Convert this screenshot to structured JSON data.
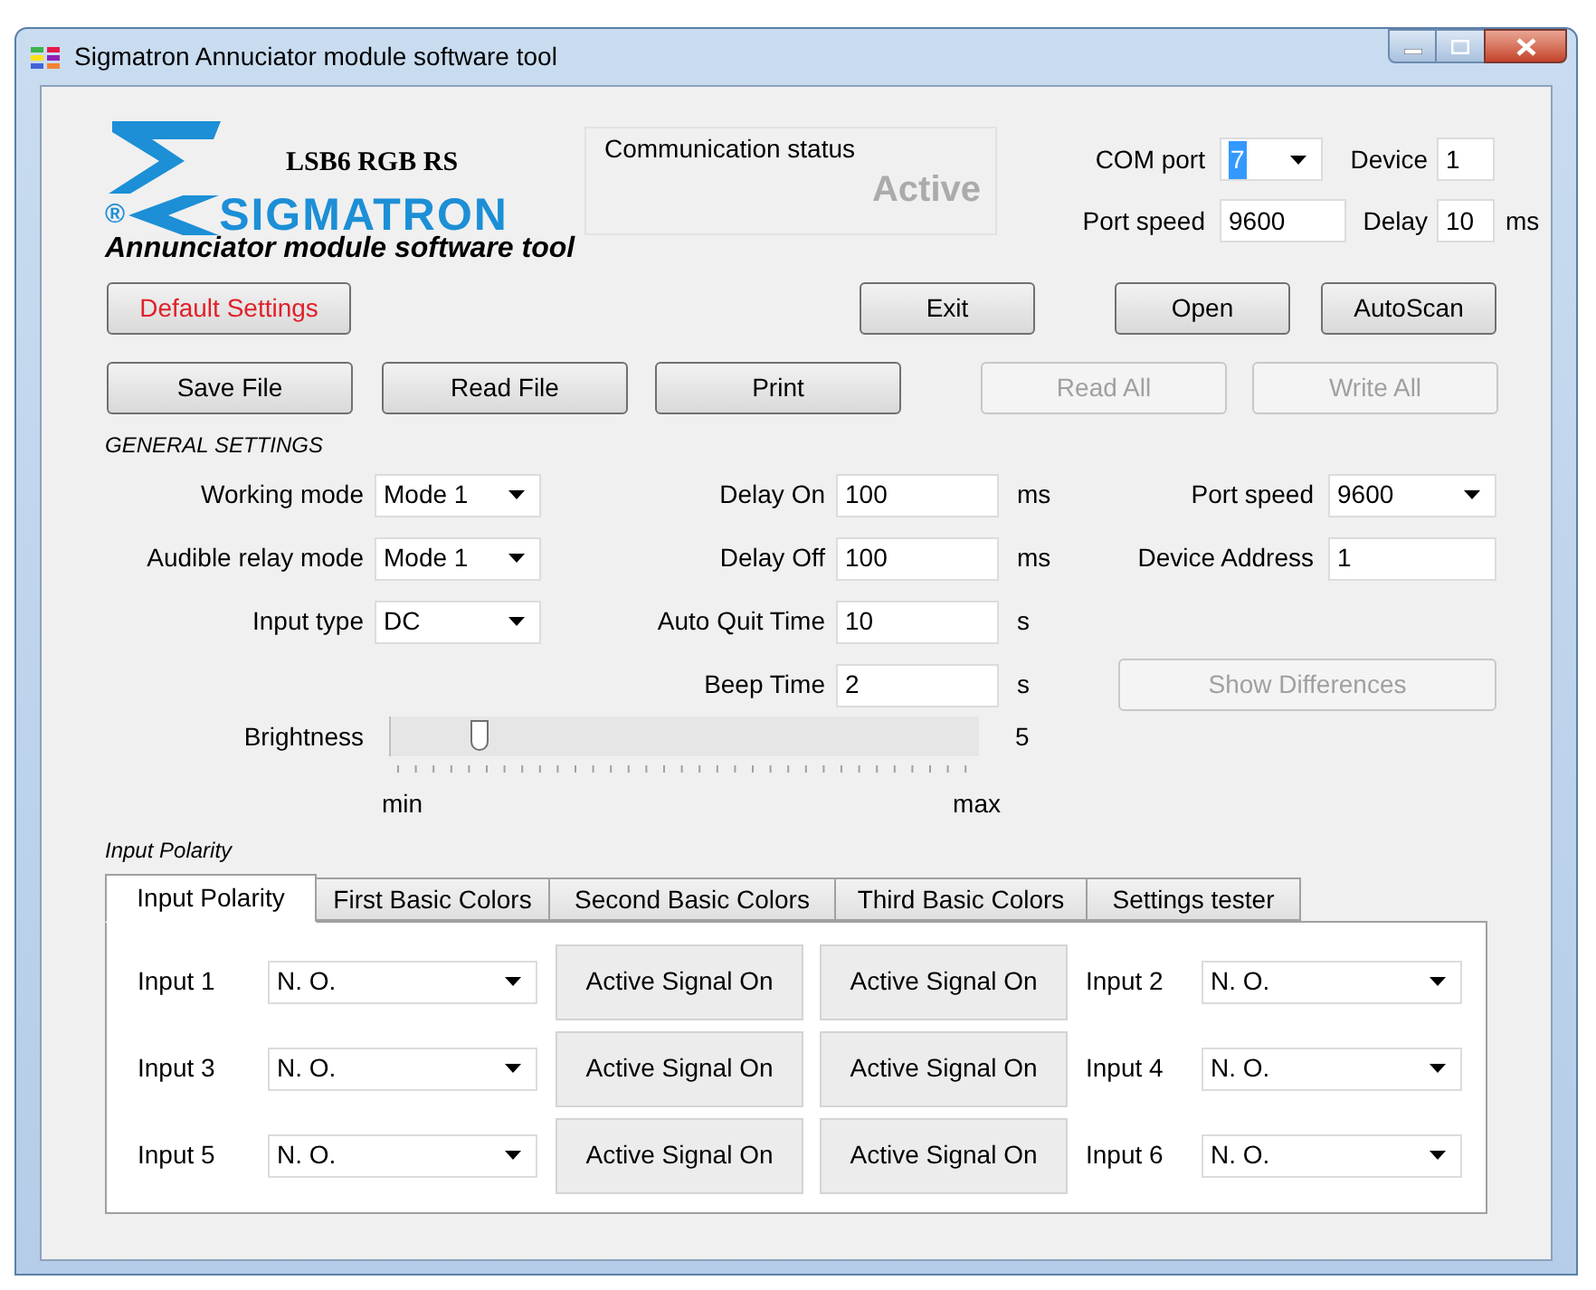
{
  "window": {
    "title": "Sigmatron Annuciator module software tool"
  },
  "header": {
    "product": "LSB6 RGB RS",
    "registered": "®",
    "brand": "SIGMATRON",
    "subtitle": "Annunciator module software tool",
    "communication_status": {
      "label": "Communication status",
      "value": "Active",
      "disabled": true
    },
    "com_port": {
      "label": "COM port",
      "value": "7",
      "highlighted": true
    },
    "device": {
      "label": "Device",
      "value": "1"
    },
    "port_speed": {
      "label": "Port speed",
      "value": "9600"
    },
    "delay": {
      "label": "Delay",
      "value": "10",
      "unit": "ms"
    }
  },
  "buttons_top": [
    {
      "label": "Default Settings",
      "kind": "warning",
      "disabled": false
    },
    {
      "label": "Exit",
      "kind": "normal",
      "disabled": false
    },
    {
      "label": "Open",
      "kind": "normal",
      "disabled": false
    },
    {
      "label": "AutoScan",
      "kind": "normal",
      "disabled": false
    }
  ],
  "buttons_file": [
    {
      "label": "Save File",
      "disabled": false
    },
    {
      "label": "Read File",
      "disabled": false
    },
    {
      "label": "Print",
      "disabled": false
    },
    {
      "label": "Read All",
      "disabled": true
    },
    {
      "label": "Write All",
      "disabled": true
    }
  ],
  "general_settings": {
    "title": "GENERAL SETTINGS",
    "rows": [
      {
        "left": {
          "label": "Working mode",
          "value": "Mode 1"
        },
        "middle": {
          "label": "Delay On",
          "value": "100",
          "unit": "ms"
        },
        "right": {
          "kind": "combo",
          "label": "Port speed",
          "value": "9600"
        }
      },
      {
        "left": {
          "label": "Audible relay mode",
          "value": "Mode 1"
        },
        "middle": {
          "label": "Delay Off",
          "value": "100",
          "unit": "ms"
        },
        "right": {
          "kind": "field",
          "label": "Device Address",
          "value": "1"
        }
      },
      {
        "left": {
          "label": "Input type",
          "value": "DC"
        },
        "middle": {
          "label": "Auto Quit Time",
          "value": "10",
          "unit": "s"
        }
      },
      {
        "middle": {
          "label": "Beep Time",
          "value": "2",
          "unit": "s"
        },
        "right": {
          "kind": "button",
          "label": "Show Differences",
          "disabled": true
        }
      }
    ],
    "brightness": {
      "label": "Brightness",
      "level": 0.14,
      "reading": "5",
      "min_label": "min",
      "max_label": "max"
    }
  },
  "input_polarity": {
    "title": "Input Polarity",
    "tabs": [
      {
        "label": "Input Polarity",
        "selected": true
      },
      {
        "label": "First Basic Colors",
        "selected": false
      },
      {
        "label": "Second Basic Colors",
        "selected": false
      },
      {
        "label": "Third Basic Colors",
        "selected": false
      },
      {
        "label": "Settings tester",
        "selected": false
      }
    ],
    "rows": [
      {
        "left": {
          "label": "Input 1",
          "value": "N. O."
        },
        "buttons": [
          "Active Signal On",
          "Active Signal On"
        ],
        "right": {
          "label": "Input 2",
          "value": "N. O."
        }
      },
      {
        "left": {
          "label": "Input 3",
          "value": "N. O."
        },
        "buttons": [
          "Active Signal On",
          "Active Signal On"
        ],
        "right": {
          "label": "Input 4",
          "value": "N. O."
        }
      },
      {
        "left": {
          "label": "Input 5",
          "value": "N. O."
        },
        "buttons": [
          "Active Signal On",
          "Active Signal On"
        ],
        "right": {
          "label": "Input 6",
          "value": "N. O."
        }
      }
    ]
  }
}
